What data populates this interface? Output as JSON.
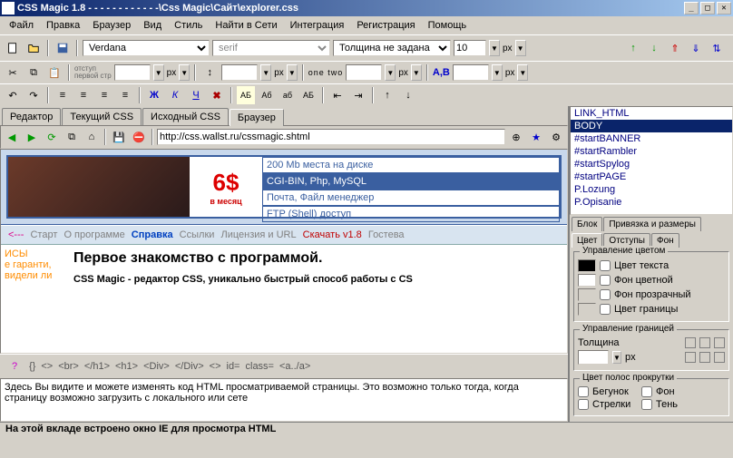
{
  "window": {
    "title": "CSS Magic 1.8 - - - - - - - - - - - -\\Css Magic\\Сайт\\explorer.css"
  },
  "menubar": [
    "Файл",
    "Правка",
    "Браузер",
    "Вид",
    "Стиль",
    "Найти в Сети",
    "Интеграция",
    "Регистрация",
    "Помощь"
  ],
  "toolbar1": {
    "font_family": "Verdana",
    "font_generic": "serif",
    "thickness": "Толщина не задана",
    "size": "10",
    "unit": "px"
  },
  "toolbar2": {
    "indent_label": "отступ\nпервой стр",
    "unit1": "px",
    "spacing_sample": "one   two",
    "unit2": "px",
    "unit3": "px",
    "ab_label": "А,В"
  },
  "toolbar3": {
    "bold": "Ж",
    "italic": "К",
    "underline": "Ч",
    "items": [
      "АБ",
      "Аб",
      "аб",
      "АБ"
    ]
  },
  "right_toolbar": {
    "arrows": true
  },
  "tabs": [
    "Редактор",
    "Текущий CSS",
    "Исходный CSS",
    "Браузер"
  ],
  "active_tab": 3,
  "browser": {
    "url": "http://css.wallst.ru/cssmagic.shtml"
  },
  "banner": {
    "price": "6$",
    "period": "в месяц",
    "list": [
      "200 Mb места на диске",
      "CGI-BIN, Php, MySQL",
      "Почта, Файл менеджер",
      "FTP (Shell) доступ"
    ],
    "list_selected": 1
  },
  "navlinks": {
    "prev": "<---",
    "items": [
      "Старт",
      "О программе",
      "Справка",
      "Ссылки",
      "Лицензия и URL",
      "Скачать v1.8",
      "Гостева"
    ],
    "colors": [
      "#808080",
      "#808080",
      "#0040c0",
      "#808080",
      "#808080",
      "#c00000",
      "#808080"
    ]
  },
  "page": {
    "side": [
      "ИСЫ",
      "е гаранти,",
      "видели ли"
    ],
    "heading": "Первое знакомство с программой.",
    "para": "CSS Magic - редактор CSS, уникально быстрый способ работы с CS"
  },
  "tagbar": [
    "{}",
    "<>",
    "<br>",
    "</h1>",
    "<h1>",
    "<Div>",
    "</Div>",
    "<>",
    "id=",
    "class=",
    "<a../a>"
  ],
  "src_text": "Здесь Вы видите и можете изменять код HTML просматриваемой страницы.\nЭто возможно только тогда, когда страницу возможно загрузить с локального или сете",
  "listbox": {
    "items": [
      "LINK_HTML",
      "BODY",
      "#startBANNER",
      "#startRambler",
      "#startSpylog",
      "#startPAGE",
      "P.Lozung",
      "P.Opisanie"
    ],
    "selected": 1
  },
  "panel_tabs_row1": [
    "Блок",
    "Привязка и размеры"
  ],
  "panel_tabs_row2": [
    "Цвет",
    "Отступы",
    "Фон"
  ],
  "active_ptab": "Цвет",
  "color_panel": {
    "group1_title": "Управление цветом",
    "rows": [
      {
        "swatch": "#000000",
        "label": "Цвет текста"
      },
      {
        "swatch": "#ffffff",
        "label": "Фон цветной"
      },
      {
        "swatch": null,
        "label": "Фон прозрачный"
      },
      {
        "swatch": null,
        "label": "Цвет границы"
      }
    ],
    "group2_title": "Управление границей",
    "thickness_label": "Толщина",
    "thickness_unit": "px",
    "group3_title": "Цвет полос прокрутки",
    "scroll_rows": [
      {
        "l1": "Бегунок",
        "l2": "Фон"
      },
      {
        "l1": "Стрелки",
        "l2": "Тень"
      }
    ]
  },
  "statusbar": "На этой вкладе встроено окно IE для просмотра HTML"
}
